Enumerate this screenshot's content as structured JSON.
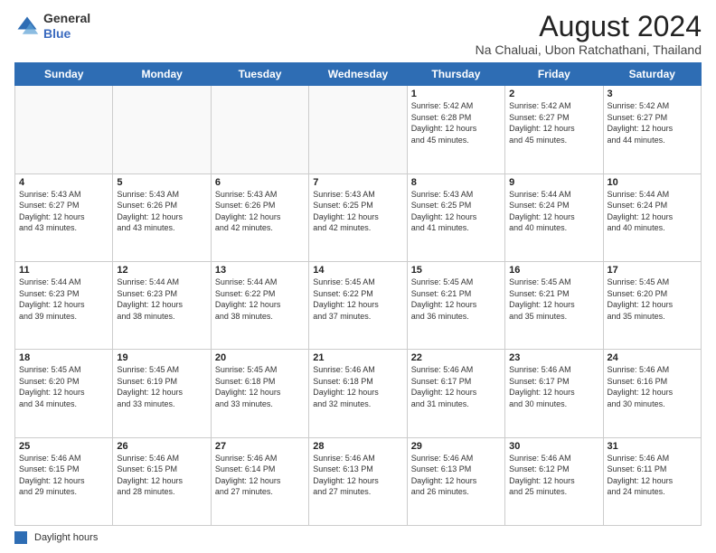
{
  "logo": {
    "line1": "General",
    "line2": "Blue"
  },
  "title": "August 2024",
  "subtitle": "Na Chaluai, Ubon Ratchathani, Thailand",
  "days_of_week": [
    "Sunday",
    "Monday",
    "Tuesday",
    "Wednesday",
    "Thursday",
    "Friday",
    "Saturday"
  ],
  "footer_legend": "Daylight hours",
  "weeks": [
    [
      {
        "day": "",
        "info": ""
      },
      {
        "day": "",
        "info": ""
      },
      {
        "day": "",
        "info": ""
      },
      {
        "day": "",
        "info": ""
      },
      {
        "day": "1",
        "info": "Sunrise: 5:42 AM\nSunset: 6:28 PM\nDaylight: 12 hours\nand 45 minutes."
      },
      {
        "day": "2",
        "info": "Sunrise: 5:42 AM\nSunset: 6:27 PM\nDaylight: 12 hours\nand 45 minutes."
      },
      {
        "day": "3",
        "info": "Sunrise: 5:42 AM\nSunset: 6:27 PM\nDaylight: 12 hours\nand 44 minutes."
      }
    ],
    [
      {
        "day": "4",
        "info": "Sunrise: 5:43 AM\nSunset: 6:27 PM\nDaylight: 12 hours\nand 43 minutes."
      },
      {
        "day": "5",
        "info": "Sunrise: 5:43 AM\nSunset: 6:26 PM\nDaylight: 12 hours\nand 43 minutes."
      },
      {
        "day": "6",
        "info": "Sunrise: 5:43 AM\nSunset: 6:26 PM\nDaylight: 12 hours\nand 42 minutes."
      },
      {
        "day": "7",
        "info": "Sunrise: 5:43 AM\nSunset: 6:25 PM\nDaylight: 12 hours\nand 42 minutes."
      },
      {
        "day": "8",
        "info": "Sunrise: 5:43 AM\nSunset: 6:25 PM\nDaylight: 12 hours\nand 41 minutes."
      },
      {
        "day": "9",
        "info": "Sunrise: 5:44 AM\nSunset: 6:24 PM\nDaylight: 12 hours\nand 40 minutes."
      },
      {
        "day": "10",
        "info": "Sunrise: 5:44 AM\nSunset: 6:24 PM\nDaylight: 12 hours\nand 40 minutes."
      }
    ],
    [
      {
        "day": "11",
        "info": "Sunrise: 5:44 AM\nSunset: 6:23 PM\nDaylight: 12 hours\nand 39 minutes."
      },
      {
        "day": "12",
        "info": "Sunrise: 5:44 AM\nSunset: 6:23 PM\nDaylight: 12 hours\nand 38 minutes."
      },
      {
        "day": "13",
        "info": "Sunrise: 5:44 AM\nSunset: 6:22 PM\nDaylight: 12 hours\nand 38 minutes."
      },
      {
        "day": "14",
        "info": "Sunrise: 5:45 AM\nSunset: 6:22 PM\nDaylight: 12 hours\nand 37 minutes."
      },
      {
        "day": "15",
        "info": "Sunrise: 5:45 AM\nSunset: 6:21 PM\nDaylight: 12 hours\nand 36 minutes."
      },
      {
        "day": "16",
        "info": "Sunrise: 5:45 AM\nSunset: 6:21 PM\nDaylight: 12 hours\nand 35 minutes."
      },
      {
        "day": "17",
        "info": "Sunrise: 5:45 AM\nSunset: 6:20 PM\nDaylight: 12 hours\nand 35 minutes."
      }
    ],
    [
      {
        "day": "18",
        "info": "Sunrise: 5:45 AM\nSunset: 6:20 PM\nDaylight: 12 hours\nand 34 minutes."
      },
      {
        "day": "19",
        "info": "Sunrise: 5:45 AM\nSunset: 6:19 PM\nDaylight: 12 hours\nand 33 minutes."
      },
      {
        "day": "20",
        "info": "Sunrise: 5:45 AM\nSunset: 6:18 PM\nDaylight: 12 hours\nand 33 minutes."
      },
      {
        "day": "21",
        "info": "Sunrise: 5:46 AM\nSunset: 6:18 PM\nDaylight: 12 hours\nand 32 minutes."
      },
      {
        "day": "22",
        "info": "Sunrise: 5:46 AM\nSunset: 6:17 PM\nDaylight: 12 hours\nand 31 minutes."
      },
      {
        "day": "23",
        "info": "Sunrise: 5:46 AM\nSunset: 6:17 PM\nDaylight: 12 hours\nand 30 minutes."
      },
      {
        "day": "24",
        "info": "Sunrise: 5:46 AM\nSunset: 6:16 PM\nDaylight: 12 hours\nand 30 minutes."
      }
    ],
    [
      {
        "day": "25",
        "info": "Sunrise: 5:46 AM\nSunset: 6:15 PM\nDaylight: 12 hours\nand 29 minutes."
      },
      {
        "day": "26",
        "info": "Sunrise: 5:46 AM\nSunset: 6:15 PM\nDaylight: 12 hours\nand 28 minutes."
      },
      {
        "day": "27",
        "info": "Sunrise: 5:46 AM\nSunset: 6:14 PM\nDaylight: 12 hours\nand 27 minutes."
      },
      {
        "day": "28",
        "info": "Sunrise: 5:46 AM\nSunset: 6:13 PM\nDaylight: 12 hours\nand 27 minutes."
      },
      {
        "day": "29",
        "info": "Sunrise: 5:46 AM\nSunset: 6:13 PM\nDaylight: 12 hours\nand 26 minutes."
      },
      {
        "day": "30",
        "info": "Sunrise: 5:46 AM\nSunset: 6:12 PM\nDaylight: 12 hours\nand 25 minutes."
      },
      {
        "day": "31",
        "info": "Sunrise: 5:46 AM\nSunset: 6:11 PM\nDaylight: 12 hours\nand 24 minutes."
      }
    ]
  ]
}
